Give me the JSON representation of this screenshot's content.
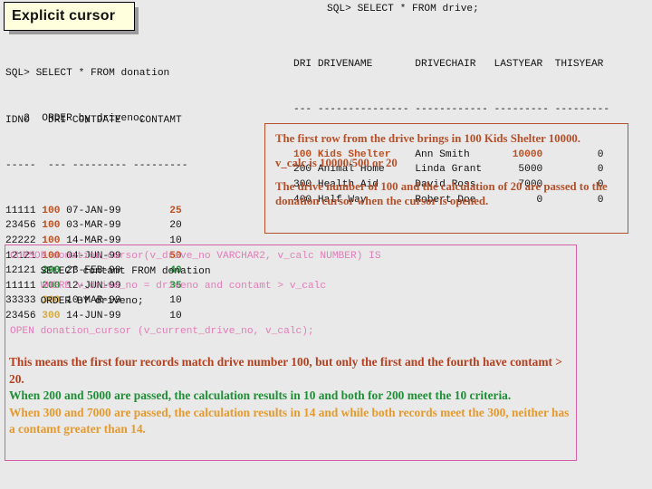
{
  "slide": {
    "title": "Explicit cursor",
    "background_color": "#e9e9e9"
  },
  "colors": {
    "title_box_fill": "#ffffdd",
    "title_box_border": "#000000",
    "title_shadow": "#9a9a9a",
    "drive_100": "#bf4f20",
    "drive_200": "#1f8f36",
    "drive_300": "#d7a83c",
    "callout_border": "#b4502a",
    "callout_text": "#b4502a",
    "pinkbox_border": "#d45fa8",
    "cursor_keyword": "#e37cb8",
    "cursor_plain": "#111111",
    "explain_100": "#b4401f",
    "explain_200": "#1f8f36",
    "explain_300": "#e59a2e"
  },
  "left_panel": {
    "prompt_lines": [
      "SQL> SELECT * FROM donation",
      "   2  ORDER by driveno;"
    ],
    "header": "IDNO   DRI CONTDATE   CONTAMT",
    "header_rule": "-----  --- --------- ---------",
    "columns": [
      "IDNO",
      "DRI",
      "CONTDATE",
      "CONTAMT"
    ],
    "rows": [
      {
        "idno": "11111",
        "dri": "100",
        "contdate": "07-JAN-99",
        "contamt": "25",
        "color": "red",
        "amt_color": "red"
      },
      {
        "idno": "23456",
        "dri": "100",
        "contdate": "03-MAR-99",
        "contamt": "20",
        "color": "red",
        "amt_color": "dark"
      },
      {
        "idno": "22222",
        "dri": "100",
        "contdate": "14-MAR-99",
        "contamt": "10",
        "color": "red",
        "amt_color": "dark"
      },
      {
        "idno": "12121",
        "dri": "100",
        "contdate": "04-JUN-99",
        "contamt": "50",
        "color": "red",
        "amt_color": "red"
      },
      {
        "idno": "12121",
        "dri": "200",
        "contdate": "23-FEB-99",
        "contamt": "40",
        "color": "green",
        "amt_color": "green"
      },
      {
        "idno": "11111",
        "dri": "200",
        "contdate": "12-JUN-99",
        "contamt": "35",
        "color": "green",
        "amt_color": "green"
      },
      {
        "idno": "33333",
        "dri": "300",
        "contdate": "10-MAR-99",
        "contamt": "10",
        "color": "gold",
        "amt_color": "dark"
      },
      {
        "idno": "23456",
        "dri": "300",
        "contdate": "14-JUN-99",
        "contamt": "10",
        "color": "gold",
        "amt_color": "dark"
      }
    ]
  },
  "right_panel": {
    "prompt_line": "SQL> SELECT * FROM drive;",
    "header": "DRI DRIVENAME       DRIVECHAIR   LASTYEAR  THISYEAR",
    "header_rule": "--- --------------- ------------ --------- ---------",
    "columns": [
      "DRI",
      "DRIVENAME",
      "DRIVECHAIR",
      "LASTYEAR",
      "THISYEAR"
    ],
    "rows": [
      {
        "dri": "100",
        "drivename": "Kids Shelter",
        "drivechair": "Ann Smith",
        "lastyear": "10000",
        "thisyear": "0",
        "color": "red"
      },
      {
        "dri": "200",
        "drivename": "Animal Home",
        "drivechair": "Linda Grant",
        "lastyear": "5000",
        "thisyear": "0",
        "color": "dark"
      },
      {
        "dri": "300",
        "drivename": "Health Aid",
        "drivechair": "David Ross",
        "lastyear": "7000",
        "thisyear": "0",
        "color": "dark"
      },
      {
        "dri": "400",
        "drivename": "Half Way",
        "drivechair": "Robert Doe",
        "lastyear": "0",
        "thisyear": "0",
        "color": "dark"
      }
    ]
  },
  "callout": {
    "lines": [
      "The first row from the drive brings in 100 Kids Shelter 10000.",
      "v_calc is 10000/500 or 20",
      "The drive number of 100 and the calculation of 20 are passed to the donation cursor when the cursor is opened."
    ]
  },
  "cursor_code": {
    "lines": [
      {
        "text": "CURSOR donation_cursor(v_drive_no VARCHAR2, v_calc NUMBER) IS",
        "color": "pink"
      },
      {
        "text": "     SELECT contamt FROM donation",
        "color": "black"
      },
      {
        "text": "     WHERE v_drive_no = driveno and contamt > v_calc",
        "color": "pink"
      },
      {
        "text": "     ORDER BY driveno;",
        "color": "black"
      },
      {
        "text": "",
        "color": "black"
      },
      {
        "text": "OPEN donation_cursor (v_current_drive_no, v_calc);",
        "color": "pink"
      }
    ]
  },
  "explanation": {
    "paragraphs": [
      {
        "text": "This means the first four records match drive number 100, but only the first and the fourth have contamt > 20.",
        "color": "brown"
      },
      {
        "text": "When 200 and 5000 are passed, the calculation results in 10 and both for 200 meet the 10 criteria.",
        "color": "green"
      },
      {
        "text": "When 300 and 7000 are passed, the calculation results in 14 and while both records meet the 300, neither has a contamt greater than 14.",
        "color": "gold"
      }
    ]
  }
}
